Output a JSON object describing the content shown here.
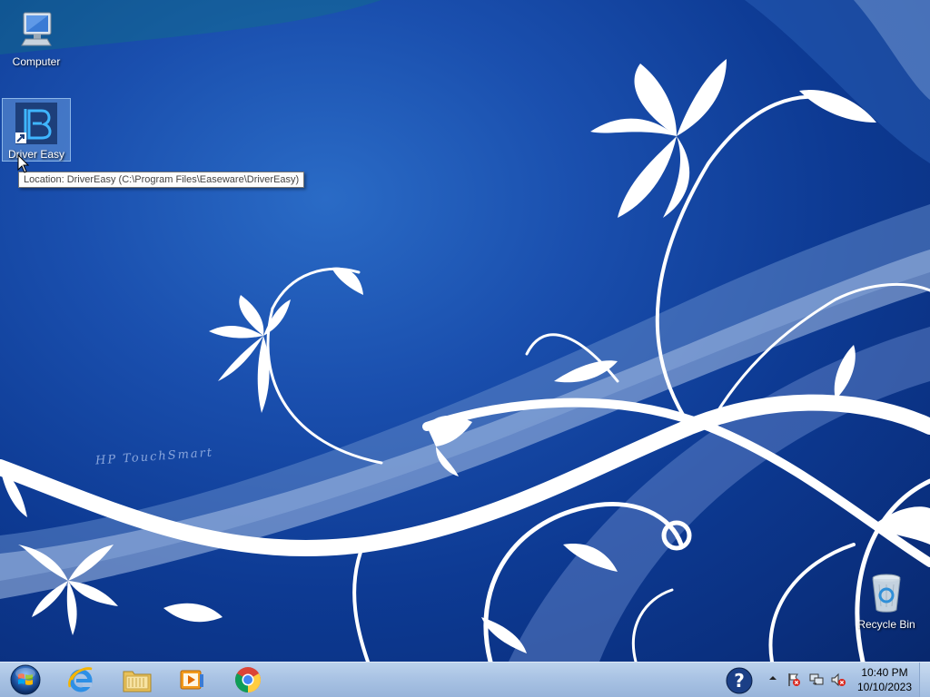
{
  "desktop": {
    "wallpaper_brand": "HP TouchSmart",
    "icons": [
      {
        "label": "Computer",
        "icon": "computer-icon"
      },
      {
        "label": "Driver Easy",
        "icon": "driver-easy-icon",
        "selected": true
      },
      {
        "label": "Recycle Bin",
        "icon": "recycle-bin-icon"
      }
    ],
    "tooltip": "Location: DriverEasy (C:\\Program Files\\Easeware\\DriverEasy)"
  },
  "taskbar": {
    "pinned": [
      {
        "name": "start-button",
        "icon": "windows-orb-icon"
      },
      {
        "name": "internet-explorer",
        "icon": "internet-explorer-icon"
      },
      {
        "name": "windows-explorer",
        "icon": "folder-icon"
      },
      {
        "name": "media-player",
        "icon": "media-player-icon"
      },
      {
        "name": "google-chrome",
        "icon": "chrome-icon"
      }
    ],
    "tray": {
      "help_icon": "help-icon",
      "icons": [
        "show-hidden-icons-arrow",
        "action-center-flag-icon",
        "network-icon",
        "volume-muted-icon"
      ],
      "time": "10:40 PM",
      "date": "10/10/2023"
    }
  },
  "colors": {
    "wallpaper_blue": "#0d3a93",
    "taskbar": "#a9c3e4",
    "selection": "#8db7e8"
  }
}
